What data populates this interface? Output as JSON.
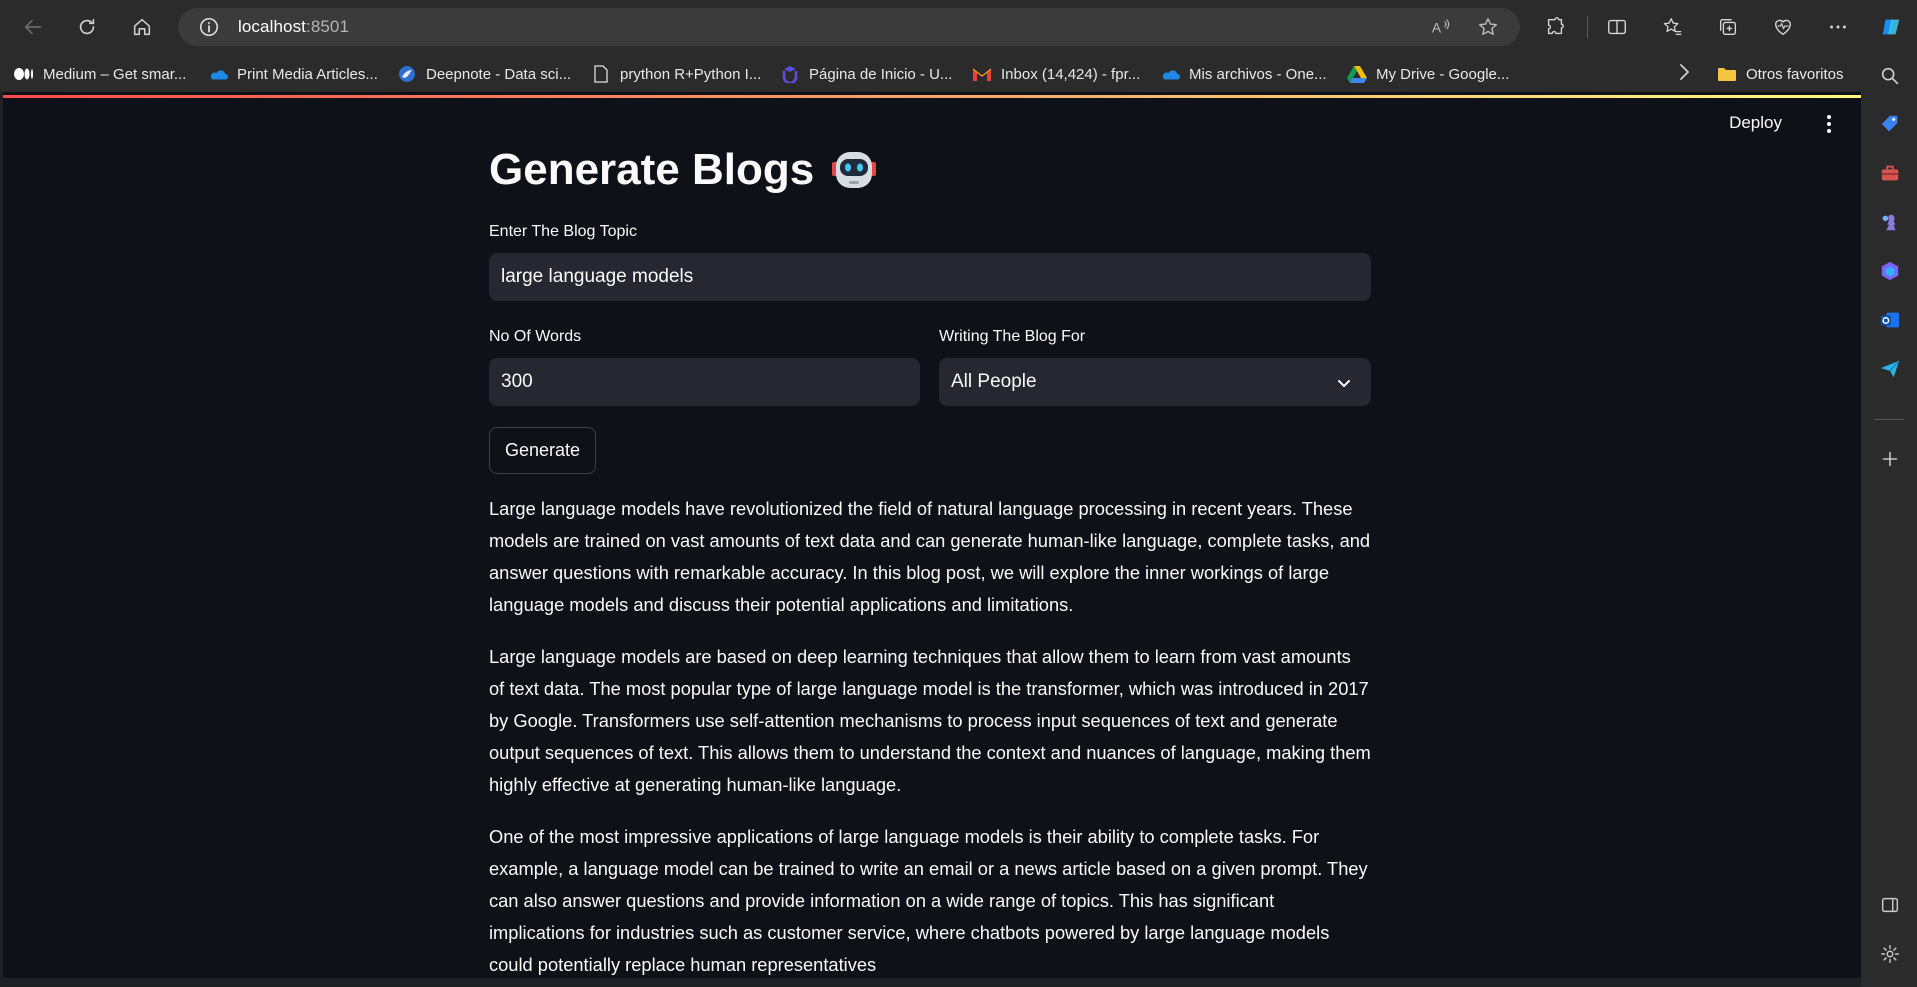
{
  "browser": {
    "url_host": "localhost",
    "url_port": ":8501"
  },
  "bookmarks": [
    {
      "label": "Medium – Get smar...",
      "icon": "medium-icon"
    },
    {
      "label": "Print Media Articles...",
      "icon": "onedrive-icon"
    },
    {
      "label": "Deepnote - Data sci...",
      "icon": "deepnote-icon"
    },
    {
      "label": "prython R+Python I...",
      "icon": "page-icon"
    },
    {
      "label": "Página de Inicio - U...",
      "icon": "udemy-icon"
    },
    {
      "label": "Inbox (14,424) - fpr...",
      "icon": "gmail-icon"
    },
    {
      "label": "Mis archivos - One...",
      "icon": "onedrive-icon"
    },
    {
      "label": "My Drive - Google...",
      "icon": "google-drive-icon"
    }
  ],
  "other_favorites": "Otros favoritos",
  "app": {
    "deploy_label": "Deploy",
    "title": "Generate Blogs",
    "topic_label": "Enter The Blog Topic",
    "topic_value": "large language models",
    "words_label": "No Of Words",
    "words_value": "300",
    "audience_label": "Writing The Blog For",
    "audience_value": "All People",
    "generate_label": "Generate",
    "paragraphs": [
      "Large language models have revolutionized the field of natural language processing in recent years. These models are trained on vast amounts of text data and can generate human-like language, complete tasks, and answer questions with remarkable accuracy. In this blog post, we will explore the inner workings of large language models and discuss their potential applications and limitations.",
      "Large language models are based on deep learning techniques that allow them to learn from vast amounts of text data. The most popular type of large language model is the transformer, which was introduced in 2017 by Google. Transformers use self-attention mechanisms to process input sequences of text and generate output sequences of text. This allows them to understand the context and nuances of language, making them highly effective at generating human-like language.",
      "One of the most impressive applications of large language models is their ability to complete tasks. For example, a language model can be trained to write an email or a news article based on a given prompt. They can also answer questions and provide information on a wide range of topics. This has significant implications for industries such as customer service, where chatbots powered by large language models could potentially replace human representatives"
    ]
  },
  "colors": {
    "app_background": "#0e1117",
    "input_background": "#262730",
    "text": "#fafafa",
    "browser_chrome": "#2b2b2b"
  }
}
